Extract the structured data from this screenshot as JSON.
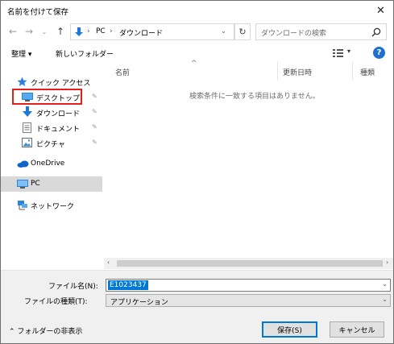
{
  "window": {
    "title": "名前を付けて保存",
    "close_glyph": "✕"
  },
  "address": {
    "crumbs": [
      "PC",
      "ダウンロード"
    ],
    "separator": "›",
    "refresh_glyph": "↻",
    "search_placeholder": "ダウンロードの検索"
  },
  "toolbar": {
    "organize_label": "整理 ▾",
    "new_folder_label": "新しいフォルダー",
    "help_glyph": "?"
  },
  "nav": {
    "quick_access": "クイック アクセス",
    "items": [
      {
        "label": "デスクトップ",
        "pinned": true
      },
      {
        "label": "ダウンロード",
        "pinned": true
      },
      {
        "label": "ドキュメント",
        "pinned": true
      },
      {
        "label": "ピクチャ",
        "pinned": true
      }
    ],
    "pin_glyph": "📌",
    "onedrive": "OneDrive",
    "pc": "PC",
    "network": "ネットワーク"
  },
  "list": {
    "columns": [
      "名前",
      "更新日時",
      "種類"
    ],
    "sort_glyph": "^",
    "empty_message": "検索条件に一致する項目はありません。"
  },
  "form": {
    "filename_label": "ファイル名(N):",
    "filename_value": "E1023437",
    "filetype_label": "ファイルの種類(T):",
    "filetype_value": "アプリケーション",
    "dropdown_glyph": "⌄"
  },
  "footer": {
    "hide_folders": "⌃ フォルダーの非表示",
    "save_label": "保存(S)",
    "cancel_label": "キャンセル"
  },
  "colors": {
    "accent": "#0078d7",
    "highlight": "#e0201a",
    "help": "#1e6fd0"
  }
}
